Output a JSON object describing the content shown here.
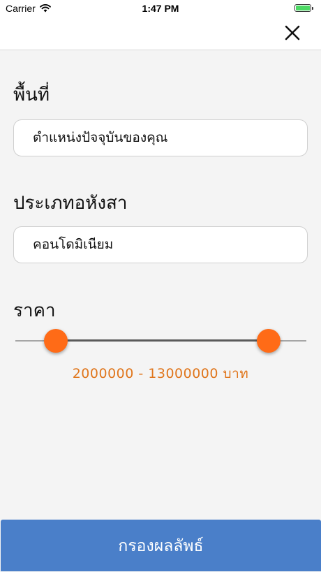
{
  "status_bar": {
    "carrier": "Carrier",
    "time": "1:47 PM",
    "battery_level": 1.0,
    "icons": [
      "wifi-icon",
      "battery-icon"
    ]
  },
  "nav": {
    "close_icon": "close-icon"
  },
  "area": {
    "title": "พื้นที่",
    "value": "ตำแหน่งปัจจุบันของคุณ"
  },
  "property_type": {
    "title": "ประเภทอหังสา",
    "value": "คอนโดมิเนียม"
  },
  "price": {
    "title": "ราคา",
    "range_text": "2000000 - 13000000 บาท",
    "min_fraction": 0.14,
    "max_fraction": 0.87
  },
  "filter_button": {
    "label": "กรองผลลัพธ์"
  },
  "colors": {
    "accent": "#ff6b17",
    "price_text": "#e0761c",
    "button": "#4a7fc9",
    "battery": "#4cd964"
  }
}
